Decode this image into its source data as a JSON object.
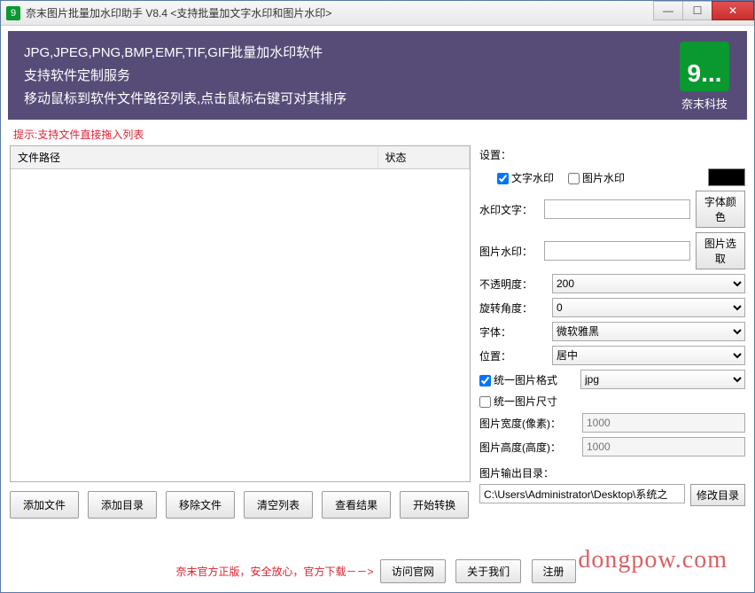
{
  "title": "奈末图片批量加水印助手 V8.4  <支持批量加文字水印和图片水印>",
  "banner": {
    "line1": "JPG,JPEG,PNG,BMP,EMF,TIF,GIF批量加水印软件",
    "line2": "支持软件定制服务",
    "line3": "移动鼠标到软件文件路径列表,点击鼠标右键可对其排序",
    "logo_glyph": "9...",
    "logo_text": "奈末科技"
  },
  "hint": "提示:支持文件直接拖入列表",
  "table": {
    "col_path": "文件路径",
    "col_status": "状态"
  },
  "buttons": {
    "add_file": "添加文件",
    "add_dir": "添加目录",
    "remove": "移除文件",
    "clear": "清空列表",
    "view": "查看结果",
    "start": "开始转换"
  },
  "settings": {
    "title": "设置：",
    "text_wm": "文字水印",
    "image_wm": "图片水印",
    "wm_text_lbl": "水印文字：",
    "font_color": "字体颜色",
    "image_wm_lbl": "图片水印：",
    "image_pick": "图片选取",
    "opacity_lbl": "不透明度：",
    "opacity_val": "200",
    "rotate_lbl": "旋转角度：",
    "rotate_val": "0",
    "font_lbl": "字体：",
    "font_val": "微软雅黑",
    "pos_lbl": "位置：",
    "pos_val": "居中",
    "unify_fmt": "统一图片格式",
    "fmt_val": "jpg",
    "unify_size": "统一图片尺寸",
    "width_lbl": "图片宽度(像素)：",
    "width_ph": "1000",
    "height_lbl": "图片高度(高度)：",
    "height_ph": "1000"
  },
  "output": {
    "label": "图片输出目录：",
    "path": "C:\\Users\\Administrator\\Desktop\\系统之",
    "change": "修改目录"
  },
  "footer": {
    "text": "奈末官方正版，安全放心，官方下载－－>",
    "visit": "访问官网",
    "about": "关于我们",
    "register": "注册"
  },
  "overlay": "dongpow.com"
}
